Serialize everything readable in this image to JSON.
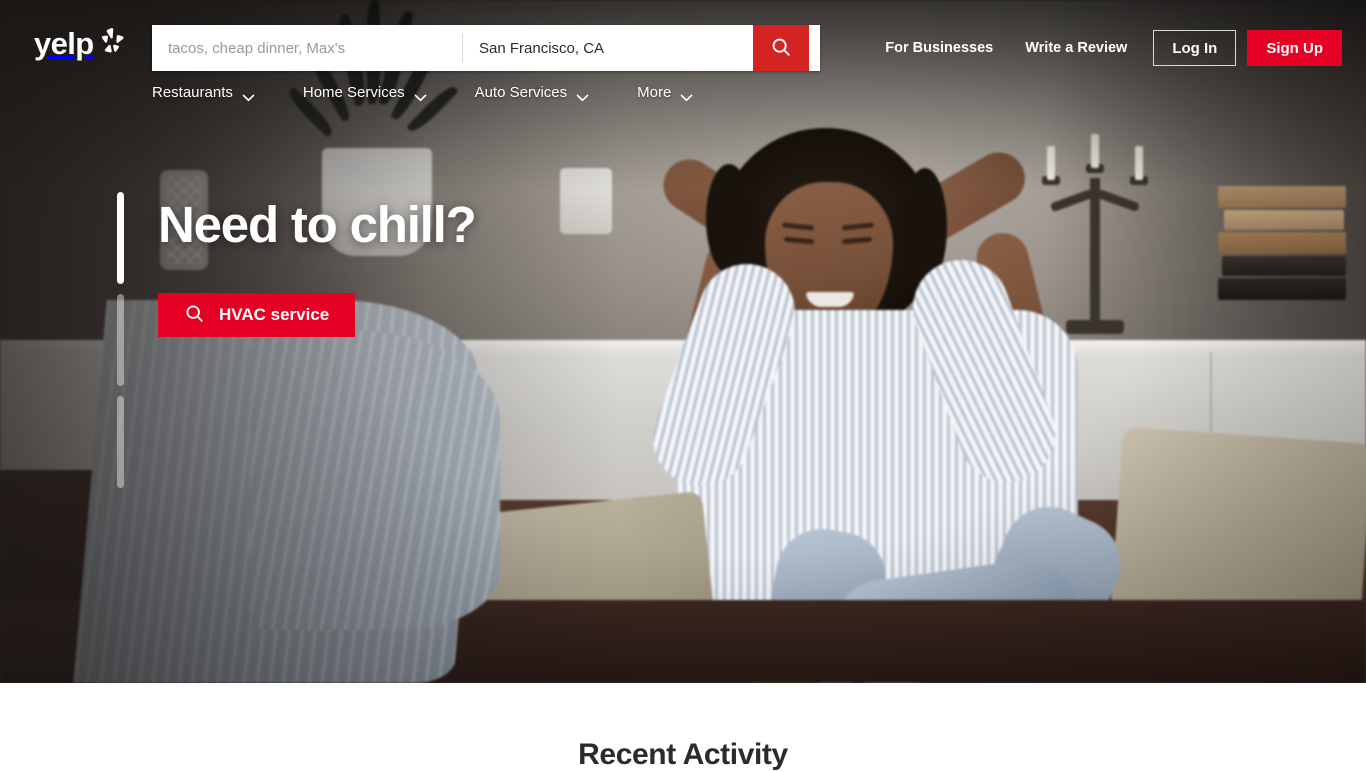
{
  "header": {
    "logo_text": "yelp",
    "logo_icon": "yelp-burst-icon",
    "search": {
      "find_placeholder": "tacos, cheap dinner, Max's",
      "find_value": "",
      "near_placeholder": "San Francisco, CA",
      "near_value": "San Francisco, CA",
      "button_icon": "search-icon"
    },
    "top_links": [
      {
        "label": "For Businesses"
      },
      {
        "label": "Write a Review"
      }
    ],
    "login_label": "Log In",
    "signup_label": "Sign Up",
    "nav": [
      {
        "label": "Restaurants",
        "icon": "chevron-down-icon"
      },
      {
        "label": "Home Services",
        "icon": "chevron-down-icon"
      },
      {
        "label": "Auto Services",
        "icon": "chevron-down-icon"
      },
      {
        "label": "More",
        "icon": "chevron-down-icon"
      }
    ]
  },
  "hero": {
    "title": "Need to chill?",
    "cta_label": "HVAC service",
    "cta_icon": "search-icon",
    "carousel": {
      "slides": 3,
      "active_index": 0,
      "fill_percents": [
        100,
        0,
        0
      ]
    }
  },
  "activity": {
    "title": "Recent Activity"
  },
  "colors": {
    "brand_red": "#d32323",
    "button_red": "#e60023",
    "text_dark": "#2b2b2b",
    "placeholder_gray": "#999999",
    "white": "#ffffff"
  }
}
